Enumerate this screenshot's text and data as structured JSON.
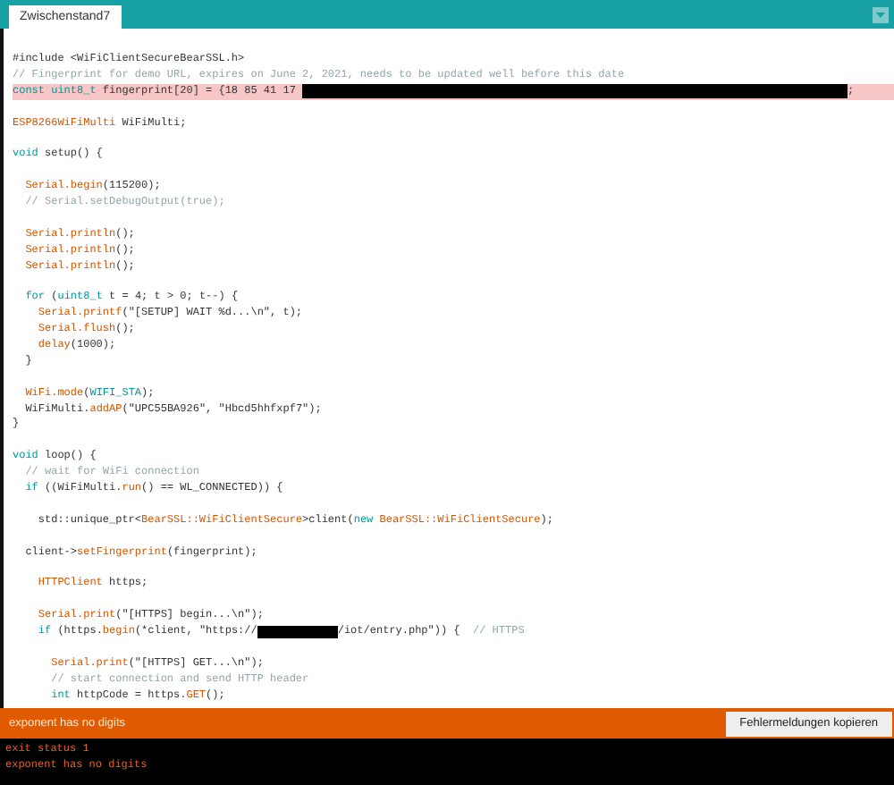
{
  "tabs": [
    {
      "label": "Zwischenstand7",
      "selected": true
    }
  ],
  "editor": {
    "lines": [
      {
        "kind": "code",
        "highlighted": false,
        "tokens": [
          {
            "kind": "plain",
            "t": "#include <WiFiClientSecureBearSSL.h>"
          }
        ]
      },
      {
        "kind": "code",
        "highlighted": false,
        "tokens": [
          {
            "kind": "comment",
            "t": "// Fingerprint for demo URL, expires on June 2, 2021, needs to be updated well before this date"
          }
        ]
      },
      {
        "kind": "code",
        "highlighted": true,
        "tokens": [
          {
            "kind": "keyword",
            "t": "const uint8_t"
          },
          {
            "kind": "plain",
            "t": " fingerprint[20] = {18 85 41 17 "
          },
          {
            "kind": "redacted"
          },
          {
            "kind": "plain",
            "t": ";"
          }
        ]
      },
      {
        "kind": "blank",
        "highlighted": false
      },
      {
        "kind": "code",
        "highlighted": false,
        "tokens": [
          {
            "kind": "object",
            "t": "ESP8266WiFiMulti"
          },
          {
            "kind": "plain",
            "t": " WiFiMulti;"
          }
        ]
      },
      {
        "kind": "blank",
        "highlighted": false
      },
      {
        "kind": "code",
        "highlighted": false,
        "tokens": [
          {
            "kind": "keyword",
            "t": "void"
          },
          {
            "kind": "plain",
            "t": " setup() {"
          }
        ]
      },
      {
        "kind": "blank",
        "highlighted": false
      },
      {
        "kind": "code",
        "highlighted": false,
        "tokens": [
          {
            "kind": "object",
            "t": "  Serial.begin"
          },
          {
            "kind": "plain",
            "t": "(115200);"
          }
        ]
      },
      {
        "kind": "code",
        "highlighted": false,
        "tokens": [
          {
            "kind": "comment",
            "t": "  // Serial.setDebugOutput(true);"
          }
        ]
      },
      {
        "kind": "blank",
        "highlighted": false
      },
      {
        "kind": "code",
        "highlighted": false,
        "tokens": [
          {
            "kind": "object",
            "t": "  Serial.println"
          },
          {
            "kind": "plain",
            "t": "();"
          }
        ]
      },
      {
        "kind": "code",
        "highlighted": false,
        "tokens": [
          {
            "kind": "object",
            "t": "  Serial.println"
          },
          {
            "kind": "plain",
            "t": "();"
          }
        ]
      },
      {
        "kind": "code",
        "highlighted": false,
        "tokens": [
          {
            "kind": "object",
            "t": "  Serial.println"
          },
          {
            "kind": "plain",
            "t": "();"
          }
        ]
      },
      {
        "kind": "blank",
        "highlighted": false
      },
      {
        "kind": "code",
        "highlighted": false,
        "tokens": [
          {
            "kind": "keyword",
            "t": "  for"
          },
          {
            "kind": "plain",
            "t": " ("
          },
          {
            "kind": "keyword",
            "t": "uint8_t"
          },
          {
            "kind": "plain",
            "t": " t = 4; t > 0; t--) {"
          }
        ]
      },
      {
        "kind": "code",
        "highlighted": false,
        "tokens": [
          {
            "kind": "object",
            "t": "    Serial.printf"
          },
          {
            "kind": "plain",
            "t": "(\"[SETUP] WAIT %d...\\n\", t);"
          }
        ]
      },
      {
        "kind": "code",
        "highlighted": false,
        "tokens": [
          {
            "kind": "object",
            "t": "    Serial.flush"
          },
          {
            "kind": "plain",
            "t": "();"
          }
        ]
      },
      {
        "kind": "code",
        "highlighted": false,
        "tokens": [
          {
            "kind": "object",
            "t": "    delay"
          },
          {
            "kind": "plain",
            "t": "(1000);"
          }
        ]
      },
      {
        "kind": "code",
        "highlighted": false,
        "tokens": [
          {
            "kind": "plain",
            "t": "  }"
          }
        ]
      },
      {
        "kind": "blank",
        "highlighted": false
      },
      {
        "kind": "code",
        "highlighted": false,
        "tokens": [
          {
            "kind": "object",
            "t": "  WiFi.mode"
          },
          {
            "kind": "plain",
            "t": "("
          },
          {
            "kind": "keyword",
            "t": "WIFI_STA"
          },
          {
            "kind": "plain",
            "t": ");"
          }
        ]
      },
      {
        "kind": "code",
        "highlighted": false,
        "tokens": [
          {
            "kind": "plain",
            "t": "  WiFiMulti."
          },
          {
            "kind": "object",
            "t": "addAP"
          },
          {
            "kind": "plain",
            "t": "(\"UPC55BA926\", \"Hbcd5hhfxpf7\");"
          }
        ]
      },
      {
        "kind": "code",
        "highlighted": false,
        "tokens": [
          {
            "kind": "plain",
            "t": "}"
          }
        ]
      },
      {
        "kind": "blank",
        "highlighted": false
      },
      {
        "kind": "code",
        "highlighted": false,
        "tokens": [
          {
            "kind": "keyword",
            "t": "void"
          },
          {
            "kind": "plain",
            "t": " loop() {"
          }
        ]
      },
      {
        "kind": "code",
        "highlighted": false,
        "tokens": [
          {
            "kind": "comment",
            "t": "  // wait for WiFi connection"
          }
        ]
      },
      {
        "kind": "code",
        "highlighted": false,
        "tokens": [
          {
            "kind": "keyword",
            "t": "  if"
          },
          {
            "kind": "plain",
            "t": " ((WiFiMulti."
          },
          {
            "kind": "object",
            "t": "run"
          },
          {
            "kind": "plain",
            "t": "() == WL_CONNECTED)) {"
          }
        ]
      },
      {
        "kind": "blank",
        "highlighted": false
      },
      {
        "kind": "code",
        "highlighted": false,
        "tokens": [
          {
            "kind": "plain",
            "t": "    std::unique_ptr<"
          },
          {
            "kind": "object",
            "t": "BearSSL::WiFiClientSecure"
          },
          {
            "kind": "plain",
            "t": ">client("
          },
          {
            "kind": "keyword",
            "t": "new"
          },
          {
            "kind": "object",
            "t": " BearSSL::WiFiClientSecure"
          },
          {
            "kind": "plain",
            "t": ");"
          }
        ]
      },
      {
        "kind": "blank",
        "highlighted": false
      },
      {
        "kind": "code",
        "highlighted": false,
        "tokens": [
          {
            "kind": "plain",
            "t": "  client->"
          },
          {
            "kind": "object",
            "t": "setFingerprint"
          },
          {
            "kind": "plain",
            "t": "(fingerprint);"
          }
        ]
      },
      {
        "kind": "blank",
        "highlighted": false
      },
      {
        "kind": "code",
        "highlighted": false,
        "tokens": [
          {
            "kind": "object",
            "t": "    HTTPClient"
          },
          {
            "kind": "plain",
            "t": " https;"
          }
        ]
      },
      {
        "kind": "blank",
        "highlighted": false
      },
      {
        "kind": "code",
        "highlighted": false,
        "tokens": [
          {
            "kind": "object",
            "t": "    Serial.print"
          },
          {
            "kind": "plain",
            "t": "(\"[HTTPS] begin...\\n\");"
          }
        ]
      },
      {
        "kind": "code",
        "highlighted": false,
        "tokens": [
          {
            "kind": "keyword",
            "t": "    if"
          },
          {
            "kind": "plain",
            "t": " (https."
          },
          {
            "kind": "object",
            "t": "begin"
          },
          {
            "kind": "plain",
            "t": "(*client, \"https://"
          },
          {
            "kind": "redacted_short"
          },
          {
            "kind": "plain",
            "t": "/iot/entry.php\")) {  "
          },
          {
            "kind": "comment",
            "t": "// HTTPS"
          }
        ]
      },
      {
        "kind": "blank",
        "highlighted": false
      },
      {
        "kind": "code",
        "highlighted": false,
        "tokens": [
          {
            "kind": "object",
            "t": "      Serial.print"
          },
          {
            "kind": "plain",
            "t": "(\"[HTTPS] GET...\\n\");"
          }
        ]
      },
      {
        "kind": "code",
        "highlighted": false,
        "tokens": [
          {
            "kind": "comment",
            "t": "      // start connection and send HTTP header"
          }
        ]
      },
      {
        "kind": "code",
        "highlighted": false,
        "tokens": [
          {
            "kind": "keyword",
            "t": "      int"
          },
          {
            "kind": "plain",
            "t": " httpCode = https."
          },
          {
            "kind": "object",
            "t": "GET"
          },
          {
            "kind": "plain",
            "t": "();"
          }
        ]
      }
    ]
  },
  "error_bar": {
    "message": "exponent has no digits",
    "button": "Fehlermeldungen kopieren"
  },
  "console": {
    "lines": [
      "exit status 1",
      "exponent has no digits"
    ]
  }
}
